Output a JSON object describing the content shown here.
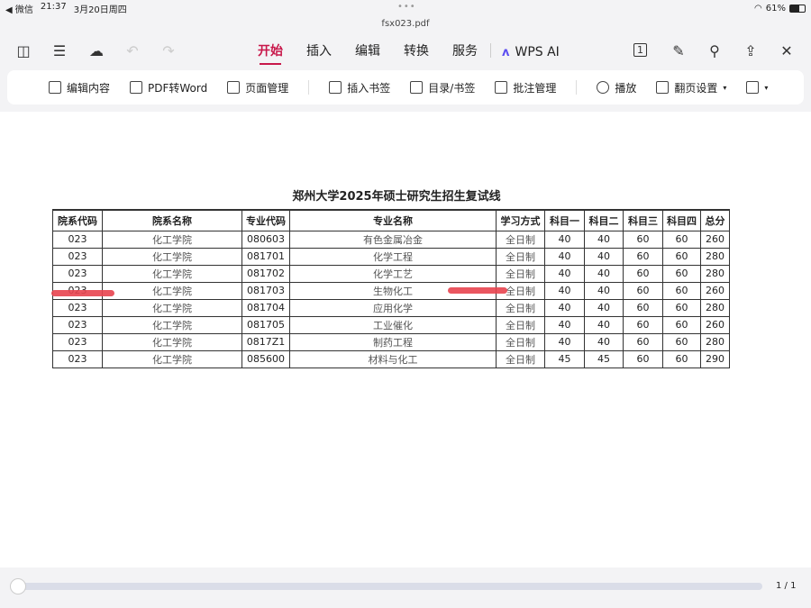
{
  "status": {
    "back": "◀ 微信",
    "time": "21:37",
    "date": "3月20日周四",
    "battery": "61%"
  },
  "file": {
    "name": "fsx023.pdf"
  },
  "tabs": [
    {
      "label": "开始",
      "active": true
    },
    {
      "label": "插入"
    },
    {
      "label": "编辑"
    },
    {
      "label": "转换"
    },
    {
      "label": "服务"
    }
  ],
  "wps_ai": "WPS AI",
  "toolbar": [
    "编辑内容",
    "PDF转Word",
    "页面管理",
    "插入书签",
    "目录/书签",
    "批注管理",
    "播放",
    "翻页设置"
  ],
  "document": {
    "title": "郑州大学2025年硕士研究生招生复试线",
    "headers": [
      "院系代码",
      "院系名称",
      "专业代码",
      "专业名称",
      "学习方式",
      "科目一",
      "科目二",
      "科目三",
      "科目四",
      "总分"
    ],
    "rows": [
      [
        "023",
        "化工学院",
        "080603",
        "有色金属冶金",
        "全日制",
        "40",
        "40",
        "60",
        "60",
        "260"
      ],
      [
        "023",
        "化工学院",
        "081701",
        "化学工程",
        "全日制",
        "40",
        "40",
        "60",
        "60",
        "280"
      ],
      [
        "023",
        "化工学院",
        "081702",
        "化学工艺",
        "全日制",
        "40",
        "40",
        "60",
        "60",
        "280"
      ],
      [
        "023",
        "化工学院",
        "081703",
        "生物化工",
        "全日制",
        "40",
        "40",
        "60",
        "60",
        "260"
      ],
      [
        "023",
        "化工学院",
        "081704",
        "应用化学",
        "全日制",
        "40",
        "40",
        "60",
        "60",
        "280"
      ],
      [
        "023",
        "化工学院",
        "081705",
        "工业催化",
        "全日制",
        "40",
        "40",
        "60",
        "60",
        "260"
      ],
      [
        "023",
        "化工学院",
        "0817Z1",
        "制药工程",
        "全日制",
        "40",
        "40",
        "60",
        "60",
        "280"
      ],
      [
        "023",
        "化工学院",
        "085600",
        "材料与化工",
        "全日制",
        "45",
        "45",
        "60",
        "60",
        "290"
      ]
    ]
  },
  "pager": {
    "label": "1 / 1",
    "progress": 0
  }
}
